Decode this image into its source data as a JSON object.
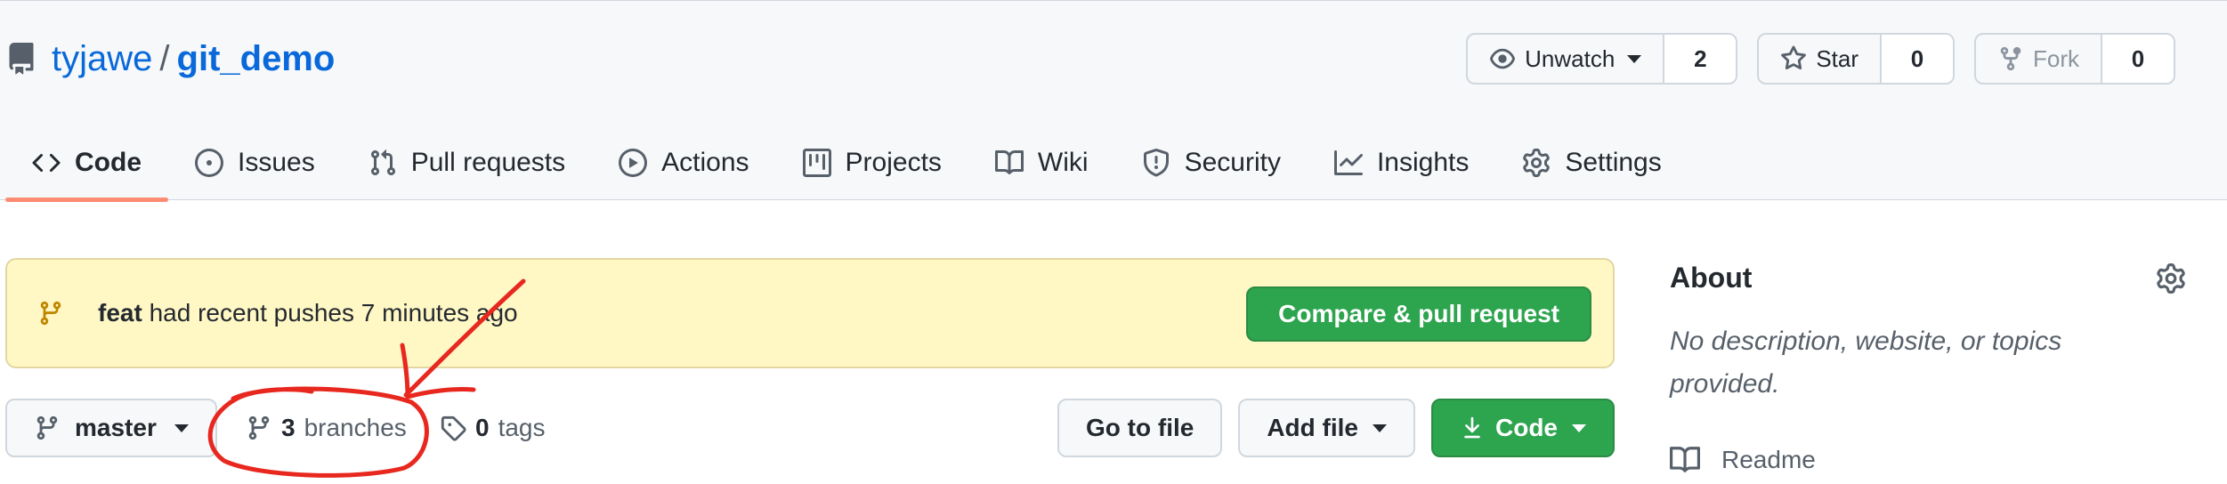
{
  "repo": {
    "owner": "tyjawe",
    "separator": "/",
    "name": "git_demo"
  },
  "actions": {
    "watch": {
      "label": "Unwatch",
      "count": "2"
    },
    "star": {
      "label": "Star",
      "count": "0"
    },
    "fork": {
      "label": "Fork",
      "count": "0"
    }
  },
  "tabs": [
    {
      "label": "Code",
      "icon": "code-icon",
      "selected": true
    },
    {
      "label": "Issues",
      "icon": "issue-icon"
    },
    {
      "label": "Pull requests",
      "icon": "pull-request-icon"
    },
    {
      "label": "Actions",
      "icon": "play-icon"
    },
    {
      "label": "Projects",
      "icon": "project-icon"
    },
    {
      "label": "Wiki",
      "icon": "book-icon"
    },
    {
      "label": "Security",
      "icon": "shield-icon"
    },
    {
      "label": "Insights",
      "icon": "graph-icon"
    },
    {
      "label": "Settings",
      "icon": "gear-icon"
    }
  ],
  "banner": {
    "branch": "feat",
    "text": "had recent pushes 7 minutes ago",
    "button": "Compare & pull request"
  },
  "filebar": {
    "branch": "master",
    "branches_count": "3",
    "branches_label": "branches",
    "tags_count": "0",
    "tags_label": "tags",
    "goto_file": "Go to file",
    "add_file": "Add file",
    "code": "Code"
  },
  "about": {
    "title": "About",
    "description": "No description, website, or topics provided.",
    "readme": "Readme"
  },
  "colors": {
    "link": "#0969da",
    "primary_green": "#2da44e",
    "tab_underline": "#fd8c73",
    "banner_bg": "#fff8c5",
    "annotation_red": "#e8281f",
    "branch_icon_in_banner": "#bf8700"
  }
}
